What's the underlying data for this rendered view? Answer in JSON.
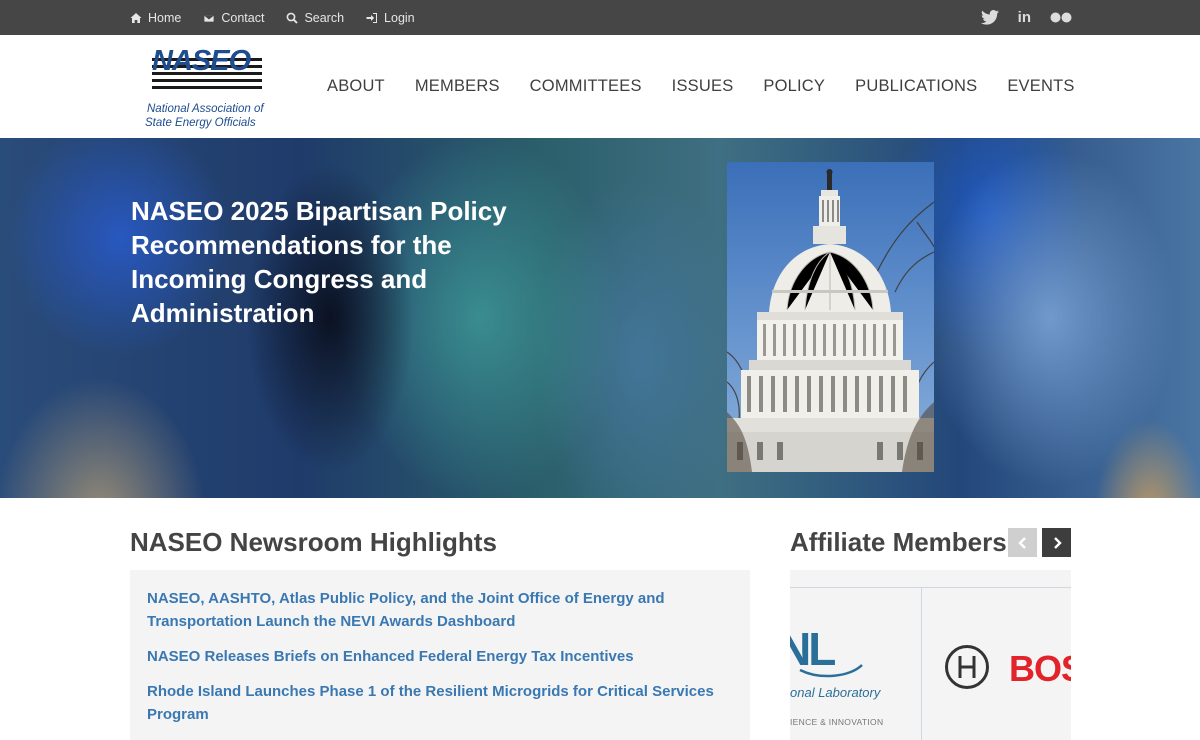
{
  "topbar": {
    "links": [
      {
        "label": "Home",
        "icon": "home-icon"
      },
      {
        "label": "Contact",
        "icon": "envelope-icon"
      },
      {
        "label": "Search",
        "icon": "search-icon"
      },
      {
        "label": "Login",
        "icon": "login-icon"
      }
    ],
    "social": [
      "twitter-icon",
      "linkedin-icon",
      "flickr-icon"
    ],
    "linkedin_text": "in"
  },
  "logo": {
    "wordmark": "NASEO",
    "line1": "National Association of",
    "line2": "State Energy Officials"
  },
  "nav": {
    "items": [
      "ABOUT",
      "MEMBERS",
      "COMMITTEES",
      "ISSUES",
      "POLICY",
      "PUBLICATIONS",
      "EVENTS"
    ]
  },
  "hero": {
    "title": "NASEO 2025 Bipartisan Policy Recommendations for the Incoming Congress and Administration",
    "image": "us-capitol-dome-photo"
  },
  "newsroom": {
    "heading": "NASEO Newsroom Highlights",
    "items": [
      "NASEO, AASHTO, Atlas Public Policy, and the Joint Office of Energy and Transportation Launch the NEVI Awards Dashboard",
      "NASEO Releases Briefs on Enhanced Federal Energy Tax Incentives",
      "Rhode Island Launches Phase 1 of the Resilient Microgrids for Critical Services Program"
    ]
  },
  "affiliates": {
    "heading": "Affiliate Members",
    "nrel_big": "NL",
    "nrel_label": "onal Laboratory",
    "nrel_sub": "IENCE & INNOVATION",
    "bosch_text": "BOS"
  },
  "colors": {
    "topbar_bg": "#464646",
    "link_blue": "#3a78b2",
    "heading_gray": "#444444",
    "bosch_red": "#e2232a"
  }
}
